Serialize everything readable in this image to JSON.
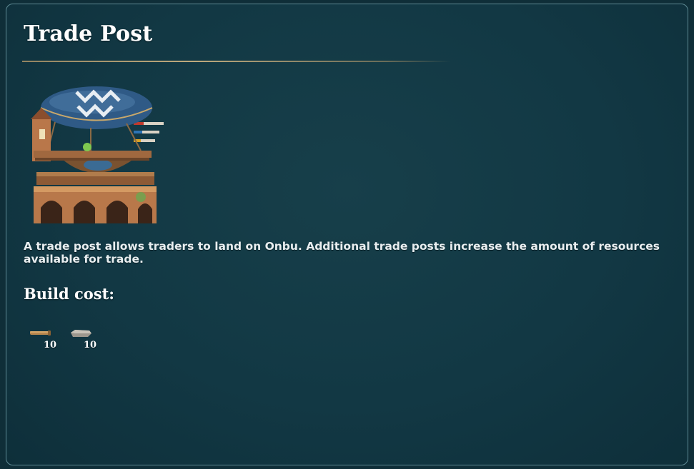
{
  "panel": {
    "title": "Trade Post",
    "building_icon": "airship-trade-post-icon",
    "description": "A trade post allows traders to land on Onbu. Additional trade posts increase the amount of resources available for trade.",
    "cost_heading": "Build cost:",
    "costs": [
      {
        "resource_icon": "wood-plank-icon",
        "amount": "10"
      },
      {
        "resource_icon": "stone-slab-icon",
        "amount": "10"
      }
    ]
  },
  "colors": {
    "background": "#123844",
    "border": "#5e8a94",
    "divider": "#c8b080",
    "text": "#ffffff"
  }
}
